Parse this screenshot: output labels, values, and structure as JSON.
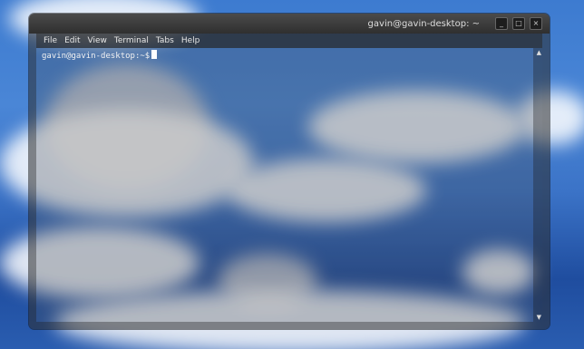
{
  "window": {
    "title": "gavin@gavin-desktop: ~",
    "controls": [
      "minimize-icon",
      "maximize-icon",
      "close-icon"
    ]
  },
  "menubar": {
    "items": [
      "File",
      "Edit",
      "View",
      "Terminal",
      "Tabs",
      "Help"
    ]
  },
  "terminal": {
    "prompt": "gavin@gavin-desktop:~$"
  },
  "colors": {
    "sky": "#3d7bd0",
    "titlebar": "#3a3a3a",
    "text": "#e6e6e6"
  }
}
